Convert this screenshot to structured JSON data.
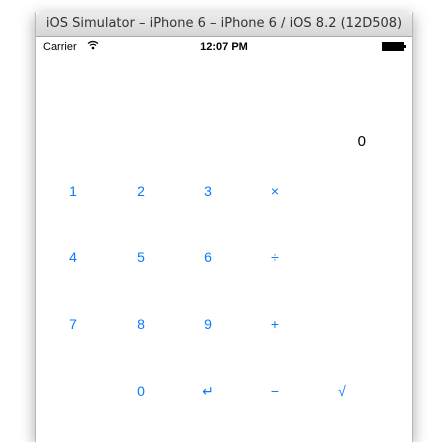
{
  "window": {
    "title": "iOS Simulator – iPhone 6 – iPhone 6 / iOS 8.2 (12D508)"
  },
  "status_bar": {
    "carrier": "Carrier",
    "time": "12:07 PM",
    "wifi_icon": "wifi-icon",
    "battery_icon": "battery-icon"
  },
  "calculator": {
    "display": "0",
    "accent_color": "#0a7aff",
    "keys": {
      "one": "1",
      "two": "2",
      "three": "3",
      "multiply": "×",
      "four": "4",
      "five": "5",
      "six": "6",
      "divide": "÷",
      "seven": "7",
      "eight": "8",
      "nine": "9",
      "add": "+",
      "zero": "0",
      "enter": "↵",
      "subtract": "−",
      "sqrt": "√"
    }
  }
}
